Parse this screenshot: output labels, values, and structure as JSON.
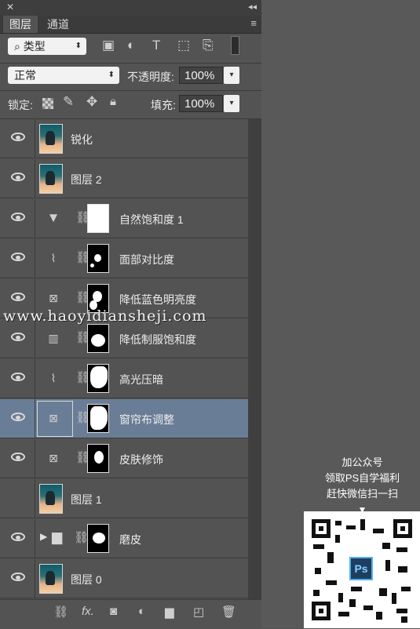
{
  "panel": {
    "close_glyph": "✕",
    "collapse_glyph": "◂◂",
    "tabs": [
      {
        "label": "图层",
        "active": true
      },
      {
        "label": "通道",
        "active": false
      }
    ],
    "menu_glyph": "≡"
  },
  "filter": {
    "type_label": "⌕ 类型",
    "icons": [
      "image-filter-icon",
      "adjustment-filter-icon",
      "type-filter-icon",
      "shape-filter-icon",
      "smart-object-filter-icon",
      "filter-toggle-icon"
    ]
  },
  "blend": {
    "mode": "正常",
    "opacity_label": "不透明度:",
    "opacity_value": "100%"
  },
  "lock": {
    "label": "锁定:",
    "fill_label": "填充:",
    "fill_value": "100%"
  },
  "layers": [
    {
      "name": "锐化",
      "kind": "photo"
    },
    {
      "name": "图层 2",
      "kind": "photo"
    },
    {
      "name": "自然饱和度 1",
      "kind": "vibrance",
      "mask": "white"
    },
    {
      "name": "面部对比度",
      "kind": "curves",
      "mask": "black"
    },
    {
      "name": "降低蓝色明亮度",
      "kind": "hsl",
      "mask": "black"
    },
    {
      "name": "降低制服饱和度",
      "kind": "channel",
      "mask": "black"
    },
    {
      "name": "高光压暗",
      "kind": "curves",
      "mask": "black"
    },
    {
      "name": "窗帘布调整",
      "kind": "hsl",
      "mask": "black",
      "selected": true
    },
    {
      "name": "皮肤修饰",
      "kind": "hsl",
      "mask": "black"
    },
    {
      "name": "图层 1",
      "kind": "photo"
    },
    {
      "name": "磨皮",
      "kind": "group",
      "mask": "black"
    },
    {
      "name": "图层 0",
      "kind": "photo"
    }
  ],
  "watermark": "www.haoyidiansheji.com",
  "promo": {
    "line1": "加公众号",
    "line2": "领取PS自学福利",
    "line3": "赶快微信扫一扫",
    "arrow": "▼",
    "logo_text": "Ps"
  },
  "colors": {
    "panel_bg": "#535353",
    "selected_row": "#6a7d96"
  }
}
